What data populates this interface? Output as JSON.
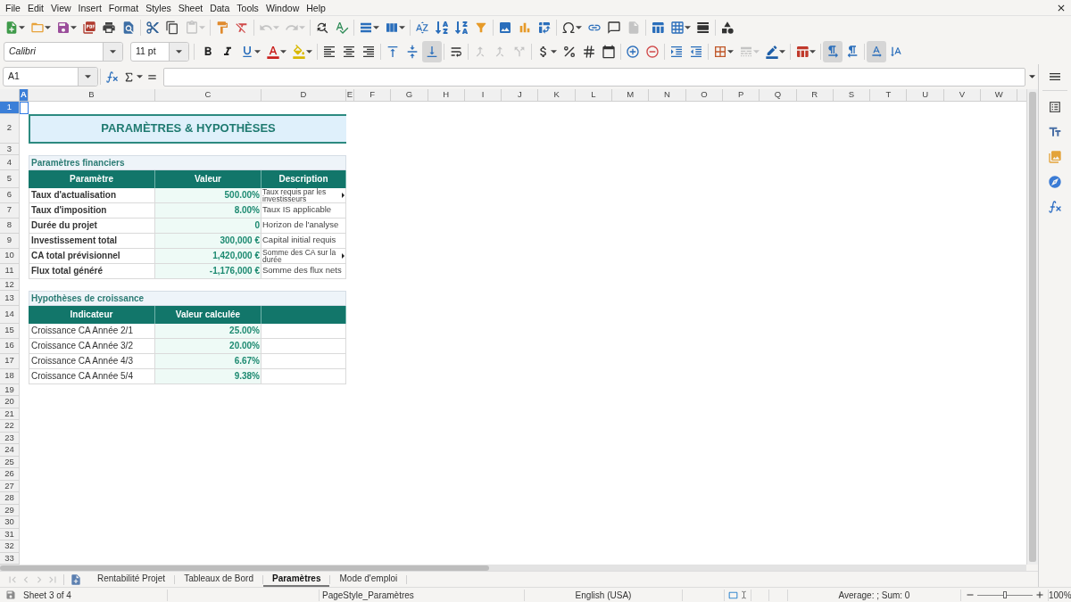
{
  "menu_bar": {
    "items": [
      "File",
      "Edit",
      "View",
      "Insert",
      "Format",
      "Styles",
      "Sheet",
      "Data",
      "Tools",
      "Window",
      "Help"
    ]
  },
  "standard_toolbar": {
    "groups": [
      [
        {
          "kind": "new",
          "disabled": false
        },
        {
          "kind": "open",
          "disabled": false
        },
        {
          "kind": "save",
          "disabled": false
        },
        {
          "kind": "export_pdf",
          "disabled": false
        },
        {
          "kind": "print",
          "disabled": false
        },
        {
          "kind": "print_preview",
          "disabled": false
        }
      ],
      [
        {
          "kind": "cut",
          "disabled": false
        },
        {
          "kind": "copy",
          "disabled": false
        },
        {
          "kind": "paste",
          "disabled": true
        }
      ],
      [
        {
          "kind": "clone_formatting",
          "disabled": false
        },
        {
          "kind": "clear_formatting",
          "disabled": false
        }
      ],
      [
        {
          "kind": "undo",
          "disabled": true
        },
        {
          "kind": "redo",
          "disabled": true
        }
      ],
      [
        {
          "kind": "find_replace",
          "disabled": false
        },
        {
          "kind": "spelling",
          "disabled": false
        }
      ],
      [
        {
          "kind": "rows",
          "disabled": false
        },
        {
          "kind": "columns",
          "disabled": false
        }
      ],
      [
        {
          "kind": "sort",
          "disabled": false
        },
        {
          "kind": "sort_ascending",
          "disabled": false
        },
        {
          "kind": "sort_descending",
          "disabled": false
        },
        {
          "kind": "autofilter",
          "disabled": false
        }
      ],
      [
        {
          "kind": "image",
          "disabled": false
        },
        {
          "kind": "chart",
          "disabled": false
        },
        {
          "kind": "pivot_table",
          "disabled": false
        }
      ],
      [
        {
          "kind": "special_character",
          "disabled": false
        },
        {
          "kind": "hyperlink",
          "disabled": false
        },
        {
          "kind": "comment",
          "disabled": false
        },
        {
          "kind": "headers_footers",
          "disabled": true
        }
      ],
      [
        {
          "kind": "print_area",
          "disabled": false
        },
        {
          "kind": "freeze",
          "disabled": false
        },
        {
          "kind": "split_window",
          "disabled": false
        }
      ],
      [
        {
          "kind": "shapes",
          "disabled": false
        }
      ]
    ]
  },
  "formatting_toolbar": {
    "font_name": "Calibri",
    "font_size": "11 pt",
    "groups": [
      [
        {
          "kind": "bold",
          "selected": false,
          "disabled": false
        },
        {
          "kind": "italic",
          "selected": false,
          "disabled": false
        },
        {
          "kind": "underline",
          "selected": false,
          "disabled": false
        },
        {
          "kind": "font_color",
          "selected": false,
          "disabled": false
        },
        {
          "kind": "highlight",
          "selected": false,
          "disabled": false
        }
      ],
      [
        {
          "kind": "align_left",
          "selected": false,
          "disabled": false
        },
        {
          "kind": "align_center",
          "selected": false,
          "disabled": false
        },
        {
          "kind": "align_right",
          "selected": false,
          "disabled": false
        }
      ],
      [
        {
          "kind": "align_top",
          "selected": false,
          "disabled": false
        },
        {
          "kind": "center_vertically",
          "selected": false,
          "disabled": false
        },
        {
          "kind": "align_bottom",
          "selected": true,
          "disabled": false
        }
      ],
      [
        {
          "kind": "wrap_text",
          "selected": false,
          "disabled": false
        }
      ],
      [
        {
          "kind": "merge_center",
          "selected": false,
          "disabled": true
        },
        {
          "kind": "merge_cells",
          "selected": false,
          "disabled": true
        },
        {
          "kind": "unmerge_cells",
          "selected": false,
          "disabled": true
        }
      ],
      [
        {
          "kind": "currency",
          "selected": false,
          "disabled": false
        },
        {
          "kind": "percent",
          "selected": false,
          "disabled": false
        },
        {
          "kind": "number",
          "selected": false,
          "disabled": false
        },
        {
          "kind": "date",
          "selected": false,
          "disabled": false
        }
      ],
      [
        {
          "kind": "add_decimal",
          "selected": false,
          "disabled": false
        },
        {
          "kind": "delete_decimal",
          "selected": false,
          "disabled": false
        }
      ],
      [
        {
          "kind": "indent_increase",
          "selected": false,
          "disabled": false
        },
        {
          "kind": "indent_decrease",
          "selected": false,
          "disabled": false
        }
      ],
      [
        {
          "kind": "borders",
          "selected": false,
          "disabled": false
        },
        {
          "kind": "border_style",
          "selected": false,
          "disabled": true
        },
        {
          "kind": "border_color",
          "selected": false,
          "disabled": false
        }
      ],
      [
        {
          "kind": "conditional",
          "selected": false,
          "disabled": false
        }
      ],
      [
        {
          "kind": "paragraph_ltr",
          "selected": true,
          "disabled": false
        },
        {
          "kind": "paragraph_rtl",
          "selected": false,
          "disabled": false
        }
      ],
      [
        {
          "kind": "text_ltr",
          "selected": true,
          "disabled": false
        },
        {
          "kind": "text_ttb",
          "selected": false,
          "disabled": false
        }
      ]
    ]
  },
  "formula_bar": {
    "name_box": "A1"
  },
  "sheet": {
    "columns": [
      {
        "label": "A",
        "selected": true
      },
      {
        "label": "B",
        "selected": false
      },
      {
        "label": "C",
        "selected": false
      },
      {
        "label": "D",
        "selected": false
      },
      {
        "label": "E",
        "selected": false
      },
      {
        "label": "F",
        "selected": false
      },
      {
        "label": "G",
        "selected": false
      },
      {
        "label": "H",
        "selected": false
      },
      {
        "label": "I",
        "selected": false
      },
      {
        "label": "J",
        "selected": false
      },
      {
        "label": "K",
        "selected": false
      },
      {
        "label": "L",
        "selected": false
      },
      {
        "label": "M",
        "selected": false
      },
      {
        "label": "N",
        "selected": false
      },
      {
        "label": "O",
        "selected": false
      },
      {
        "label": "P",
        "selected": false
      },
      {
        "label": "Q",
        "selected": false
      },
      {
        "label": "R",
        "selected": false
      },
      {
        "label": "S",
        "selected": false
      },
      {
        "label": "T",
        "selected": false
      },
      {
        "label": "U",
        "selected": false
      },
      {
        "label": "V",
        "selected": false
      },
      {
        "label": "W",
        "selected": false
      }
    ],
    "rows": [
      {
        "label": "1",
        "selected": true
      },
      {
        "label": "2",
        "selected": false
      },
      {
        "label": "3",
        "selected": false
      },
      {
        "label": "4",
        "selected": false
      },
      {
        "label": "5",
        "selected": false
      },
      {
        "label": "6",
        "selected": false
      },
      {
        "label": "7",
        "selected": false
      },
      {
        "label": "8",
        "selected": false
      },
      {
        "label": "9",
        "selected": false
      },
      {
        "label": "10",
        "selected": false
      },
      {
        "label": "11",
        "selected": false
      },
      {
        "label": "12",
        "selected": false
      },
      {
        "label": "13",
        "selected": false
      },
      {
        "label": "14",
        "selected": false
      },
      {
        "label": "15",
        "selected": false
      },
      {
        "label": "16",
        "selected": false
      },
      {
        "label": "17",
        "selected": false
      },
      {
        "label": "18",
        "selected": false
      },
      {
        "label": "19",
        "selected": false
      },
      {
        "label": "20",
        "selected": false
      },
      {
        "label": "21",
        "selected": false
      },
      {
        "label": "22",
        "selected": false
      },
      {
        "label": "23",
        "selected": false
      },
      {
        "label": "24",
        "selected": false
      },
      {
        "label": "25",
        "selected": false
      },
      {
        "label": "26",
        "selected": false
      },
      {
        "label": "27",
        "selected": false
      },
      {
        "label": "28",
        "selected": false
      },
      {
        "label": "29",
        "selected": false
      },
      {
        "label": "30",
        "selected": false
      },
      {
        "label": "31",
        "selected": false
      },
      {
        "label": "32",
        "selected": false
      },
      {
        "label": "33",
        "selected": false
      }
    ],
    "title": "PARAMÈTRES & HYPOTHÈSES",
    "sections": [
      {
        "title": "Paramètres financiers",
        "headers": [
          "Paramètre",
          "Valeur",
          "Description"
        ],
        "rows": [
          {
            "label": "Taux d'actualisation",
            "value": "500.00%",
            "description": "Taux requis par les investisseurs",
            "clipped": true
          },
          {
            "label": "Taux d'imposition",
            "value": "8.00%",
            "description": "Taux IS applicable",
            "clipped": false
          },
          {
            "label": "Durée du projet",
            "value": "0",
            "description": "Horizon de l'analyse",
            "clipped": false
          },
          {
            "label": "Investissement total",
            "value": "300,000 €",
            "description": "Capital initial requis",
            "clipped": false
          },
          {
            "label": "CA total prévisionnel",
            "value": "1,420,000 €",
            "description": "Somme des CA sur la durée",
            "clipped": true
          },
          {
            "label": "Flux total généré",
            "value": "-1,176,000 €",
            "description": "Somme des flux nets",
            "clipped": false
          }
        ]
      },
      {
        "title": "Hypothèses de croissance",
        "headers": [
          "Indicateur",
          "Valeur calculée"
        ],
        "rows": [
          {
            "label": "Croissance CA Année 2/1",
            "value": "25.00%",
            "clipped": false
          },
          {
            "label": "Croissance CA Année 3/2",
            "value": "20.00%",
            "clipped": false
          },
          {
            "label": "Croissance CA Année 4/3",
            "value": "6.67%",
            "clipped": false
          },
          {
            "label": "Croissance CA Année 5/4",
            "value": "9.38%",
            "clipped": false
          }
        ]
      }
    ]
  },
  "sheet_tab_bar": {
    "navigation": [
      {
        "kind": "first",
        "disabled": true
      },
      {
        "kind": "previous",
        "disabled": true
      },
      {
        "kind": "next",
        "disabled": true
      },
      {
        "kind": "last",
        "disabled": true
      }
    ],
    "tabs": [
      {
        "label": "Rentabilité Projet",
        "selected": false
      },
      {
        "label": "Tableaux de Bord",
        "selected": false
      },
      {
        "label": "Paramètres",
        "selected": true
      },
      {
        "label": "Mode d'emploi",
        "selected": false
      }
    ]
  },
  "status_bar": {
    "sheet_position": "Sheet 3 of 4",
    "page_style": "PageStyle_Paramètres",
    "language": "English (USA)",
    "selection_summary": "Average: ; Sum: 0",
    "zoom": {
      "level": 0.5,
      "reading": "100%"
    }
  }
}
